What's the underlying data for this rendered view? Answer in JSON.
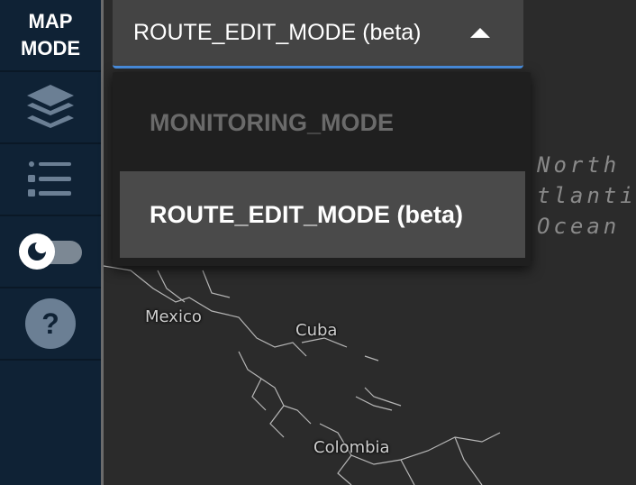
{
  "sidebar": {
    "title_line1": "MAP",
    "title_line2": "MODE",
    "help_label": "?"
  },
  "mode_select": {
    "value": "ROUTE_EDIT_MODE (beta)",
    "options": [
      {
        "label": "MONITORING_MODE",
        "state": "disabled"
      },
      {
        "label": "ROUTE_EDIT_MODE (beta)",
        "state": "selected"
      }
    ]
  },
  "map": {
    "labels": {
      "mexico": "Mexico",
      "cuba": "Cuba",
      "colombia": "Colombia",
      "ocean": "North\ntlantic\nOcean"
    }
  },
  "colors": {
    "sidebar_bg": "#0f2235",
    "accent": "#4a90e2",
    "select_bg": "#444444",
    "menu_bg": "#1f1f1f",
    "map_bg": "#2b2b2b"
  }
}
